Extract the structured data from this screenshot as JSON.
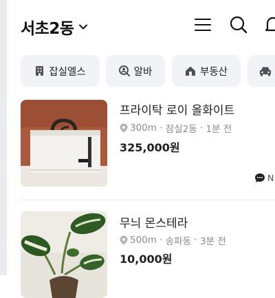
{
  "header": {
    "location": "서초2동"
  },
  "chips": [
    {
      "label": "잡실엘스",
      "icon": "building-icon"
    },
    {
      "label": "알바",
      "icon": "user-search-icon"
    },
    {
      "label": "부동산",
      "icon": "house-icon"
    },
    {
      "label": "",
      "icon": "car-icon"
    }
  ],
  "items": [
    {
      "title": "프라이탁 로이 올화이트",
      "distance": "300m",
      "area": "잠실2동",
      "time": "1분 전",
      "price": "325,000원",
      "chat_label": "N"
    },
    {
      "title": "무늬 몬스테라",
      "distance": "500m",
      "area": "송파동",
      "time": "3분 전",
      "price": "10,000원"
    }
  ],
  "colors": {
    "meta_gray": "#868b94",
    "chip_bg": "#f2f3f6",
    "text": "#212124"
  }
}
